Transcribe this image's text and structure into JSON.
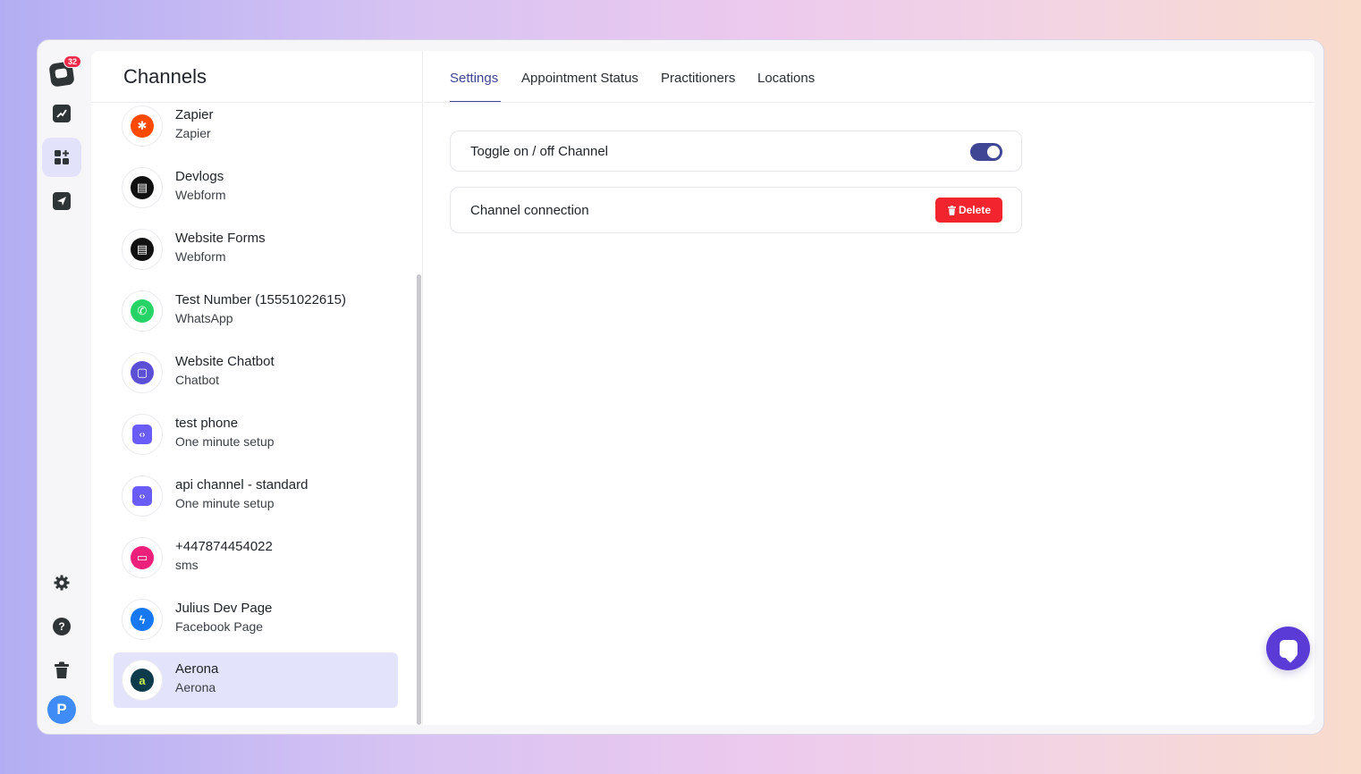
{
  "rail": {
    "notification_count": "32",
    "items": [
      {
        "icon": "inbox-logo-icon"
      },
      {
        "icon": "analytics-icon"
      },
      {
        "icon": "channels-icon",
        "active": true
      },
      {
        "icon": "send-icon"
      },
      {
        "icon": "settings-icon"
      },
      {
        "icon": "help-icon",
        "glyph": "?"
      },
      {
        "icon": "trash-icon"
      }
    ],
    "avatar_initial": "P"
  },
  "list": {
    "title": "Channels",
    "channels": [
      {
        "name": "Zapier",
        "type": "Zapier",
        "icon": "zapier-icon",
        "color": "#ff4a00",
        "glyph": "✱"
      },
      {
        "name": "Devlogs",
        "type": "Webform",
        "icon": "webform-icon",
        "color": "#111111",
        "glyph": "▤"
      },
      {
        "name": "Website Forms",
        "type": "Webform",
        "icon": "webform-icon",
        "color": "#111111",
        "glyph": "▤"
      },
      {
        "name": "Test Number (15551022615)",
        "type": "WhatsApp",
        "icon": "whatsapp-icon",
        "color": "#25d366",
        "glyph": "✆"
      },
      {
        "name": "Website Chatbot",
        "type": "Chatbot",
        "icon": "chatbot-icon",
        "color": "#5b4fd6",
        "glyph": "▢"
      },
      {
        "name": "test phone",
        "type": "One minute setup",
        "icon": "code-icon",
        "color": "#6a5cf6",
        "glyph": "‹›"
      },
      {
        "name": "api channel - standard",
        "type": "One minute setup",
        "icon": "code-icon",
        "color": "#6a5cf6",
        "glyph": "‹›"
      },
      {
        "name": "+447874454022",
        "type": "sms",
        "icon": "sms-icon",
        "color": "#ec1f7a",
        "glyph": "▭"
      },
      {
        "name": "Julius Dev Page",
        "type": "Facebook Page",
        "icon": "messenger-icon",
        "color": "#1877f2",
        "glyph": "ϟ"
      },
      {
        "name": "Aerona",
        "type": "Aerona",
        "icon": "aerona-icon",
        "color": "#0d3b4c",
        "glyph": "a",
        "selected": true
      }
    ]
  },
  "detail": {
    "tabs": [
      "Settings",
      "Appointment Status",
      "Practitioners",
      "Locations"
    ],
    "active_tab": "Settings",
    "toggle_card": {
      "label": "Toggle on / off Channel",
      "enabled": true
    },
    "connection_card": {
      "label": "Channel connection",
      "delete_label": "Delete"
    }
  },
  "colors": {
    "accent": "#3f4694",
    "danger": "#f2252f",
    "selection": "#e3e4fb",
    "fab": "#5b3bd6"
  }
}
